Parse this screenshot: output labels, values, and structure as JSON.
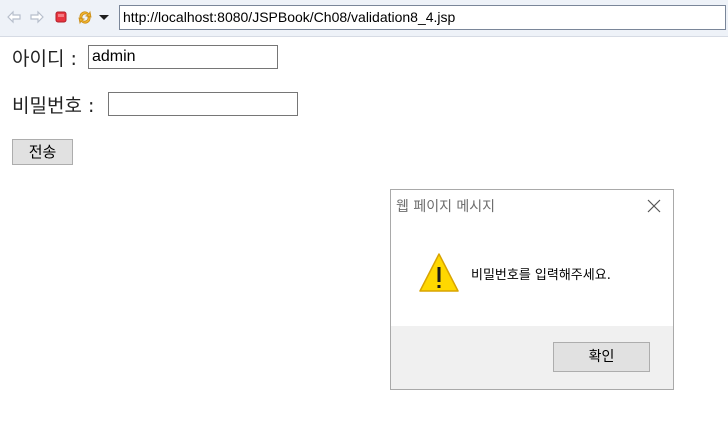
{
  "browser": {
    "url": "http://localhost:8080/JSPBook/Ch08/validation8_4.jsp",
    "icons": [
      "back-arrow-icon",
      "forward-arrow-icon",
      "stop-icon",
      "refresh-icon",
      "dropdown-arrow-icon"
    ]
  },
  "form": {
    "id_label": "아이디 :",
    "id_value": "admin",
    "password_label": "비밀번호 :",
    "password_value": "",
    "submit_label": "전송"
  },
  "dialog": {
    "title": "웹 페이지 메시지",
    "message": "비밀번호를 입력해주세요.",
    "ok_label": "확인",
    "icon": "warning-icon",
    "colors": {
      "warning_fill": "#ffd800",
      "warning_stroke": "#d9a400"
    }
  }
}
